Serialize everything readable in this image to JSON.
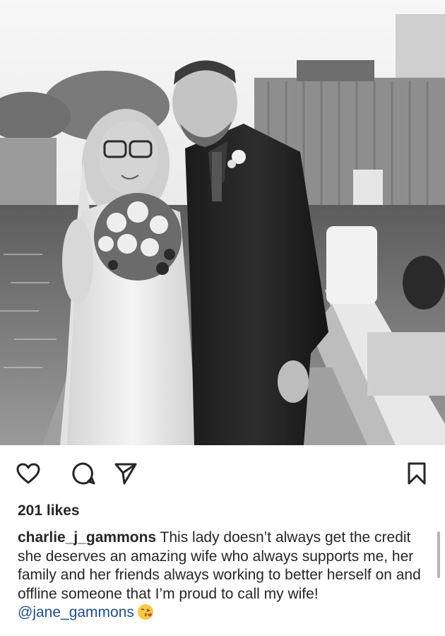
{
  "post": {
    "photo_alt": "",
    "likes": "201 likes",
    "caption": {
      "username": "charlie_j_gammons",
      "text": " This lady doesn’t always get the credit she deserves an amazing wife who always supports me, her family and her friends always working to better herself on and offline someone that I’m proud to call my wife! ",
      "mention": "@jane_gammons",
      "emoji": "face-blowing-kiss"
    }
  },
  "actions": {
    "like_icon": "heart-icon",
    "comment_icon": "comment-icon",
    "share_icon": "share-icon",
    "save_icon": "bookmark-icon"
  },
  "colors": {
    "text": "#262626",
    "mention": "#1f4e87",
    "scrollbar": "#b5b5b5"
  }
}
